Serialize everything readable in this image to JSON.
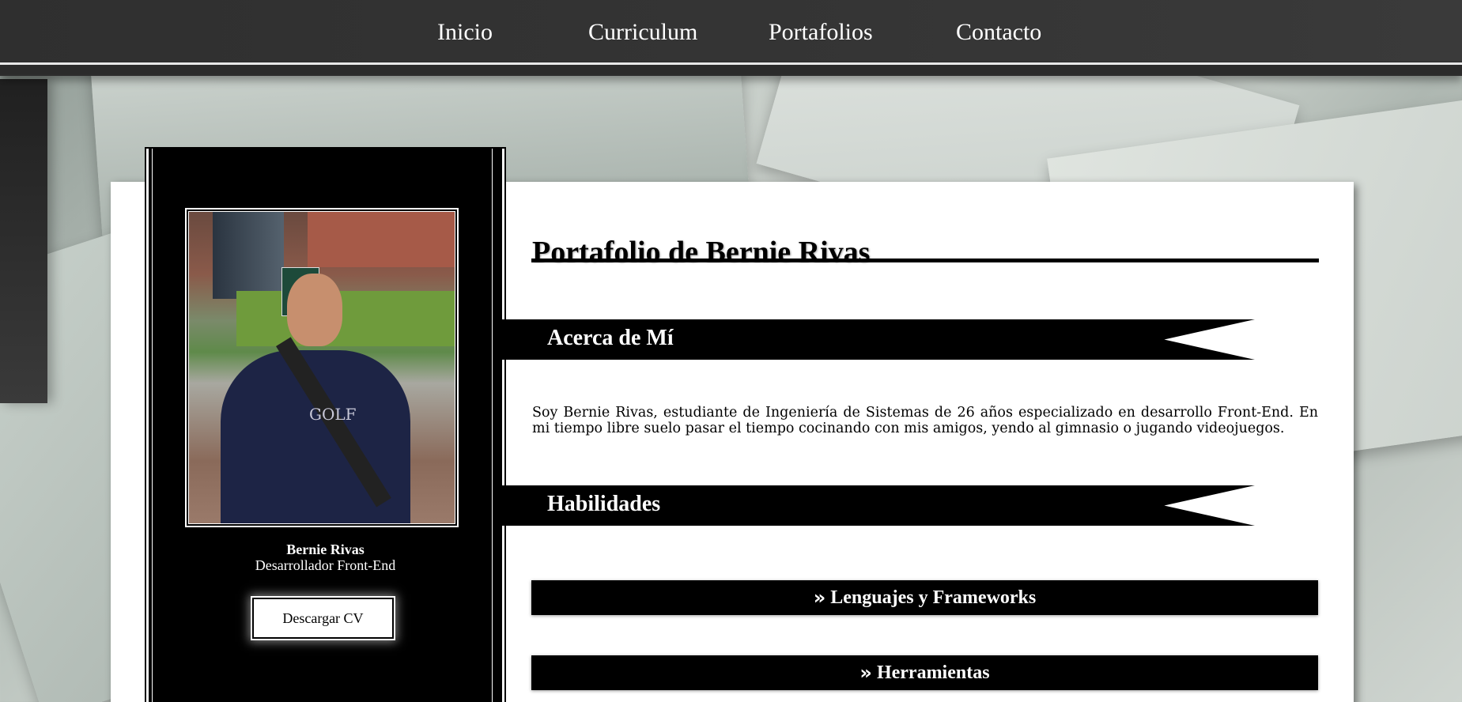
{
  "nav": {
    "items": [
      {
        "label": "Inicio"
      },
      {
        "label": "Curriculum"
      },
      {
        "label": "Portafolios"
      },
      {
        "label": "Contacto"
      }
    ]
  },
  "profile": {
    "name": "Bernie Rivas",
    "role": "Desarrollador Front-End",
    "cv_button": "Descargar CV",
    "photo_logo_text": "GOLF"
  },
  "header": {
    "title_prefix": "Portafolio de",
    "title_name": "Bernie Rivas"
  },
  "sections": {
    "about": {
      "title": "Acerca de Mí",
      "text": "Soy Bernie Rivas, estudiante de Ingeniería de Sistemas de 26 años especializado en desarrollo Front-End. En mi tiempo libre suelo pasar el tiempo cocinando con mis amigos, yendo al gimnasio o jugando videojuegos."
    },
    "skills": {
      "title": "Habilidades",
      "groups": [
        {
          "label": "Lenguajes y Frameworks"
        },
        {
          "label": "Herramientas"
        }
      ]
    }
  },
  "colors": {
    "nav_bg": "#2d2d2d",
    "panel_bg": "#ffffff",
    "sidebar_bg": "#000000",
    "accent_text": "#ffffff"
  },
  "icons": {
    "accordion_chevron": "double-chevron-right-icon"
  }
}
